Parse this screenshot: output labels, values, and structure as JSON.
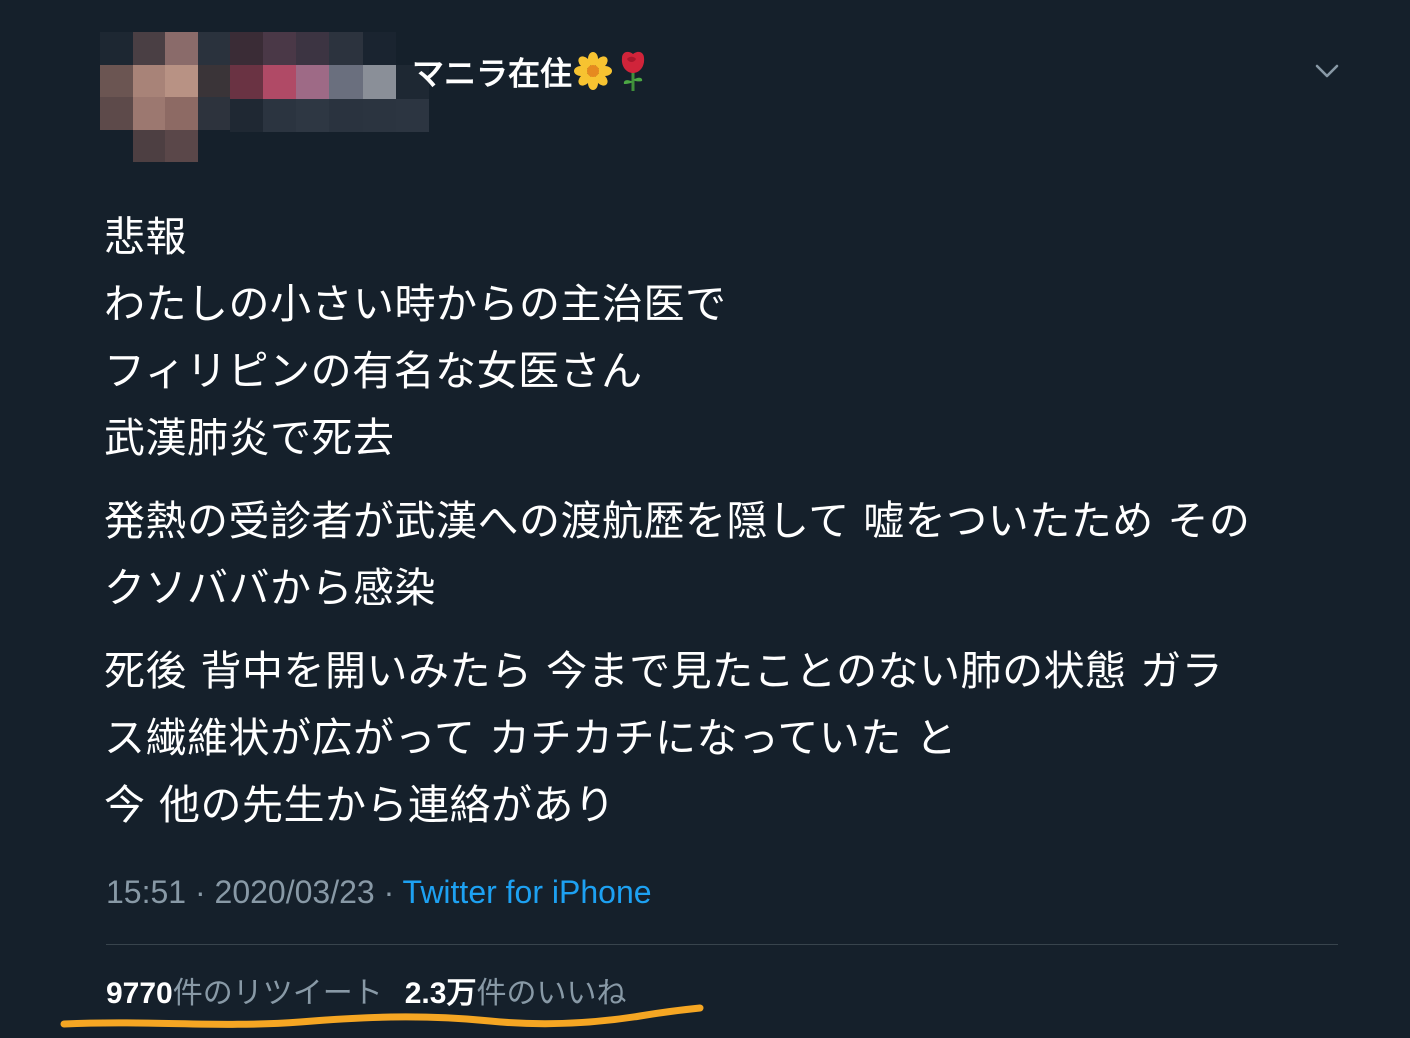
{
  "tweet": {
    "display_name": "マニラ在住",
    "name_emojis": [
      "sunflower-emoji",
      "rose-emoji"
    ],
    "body_paragraphs": [
      [
        "悲報",
        "わたしの小さい時からの主治医で",
        "フィリピンの有名な女医さん",
        "武漢肺炎で死去"
      ],
      [
        "発熱の受診者が武漢への渡航歴を隠して 嘘をついたため その",
        "クソババから感染"
      ],
      [
        "死後 背中を開いみたら 今まで見たことのない肺の状態  ガラ",
        "ス繊維状が広がって カチカチになっていた と",
        "今 他の先生から連絡があり"
      ]
    ],
    "time": "15:51",
    "separator": "·",
    "date": "2020/03/23",
    "source": "Twitter for iPhone",
    "retweet_count": "9770",
    "retweet_label": "件のリツイート",
    "like_count": "2.3万",
    "like_label": "件のいいね"
  },
  "colors": {
    "background": "#15202b",
    "text": "#ffffff",
    "muted": "#8899a6",
    "link": "#1da1f2",
    "divider": "#38444d",
    "highlight": "#f5a623"
  },
  "icons": {
    "menu": "chevron-down-icon",
    "avatar": "pixelated-avatar"
  }
}
